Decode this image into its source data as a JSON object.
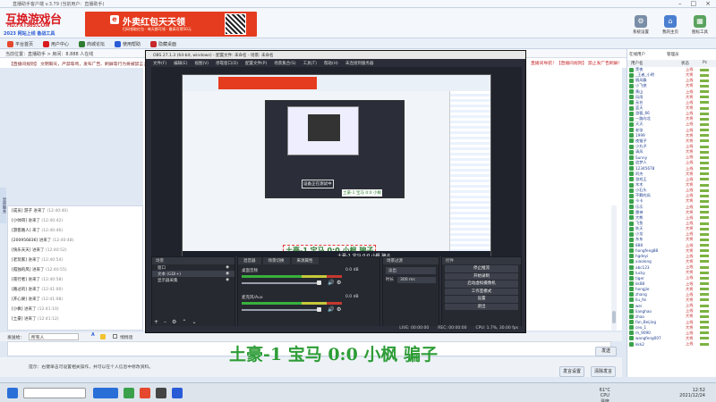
{
  "window": {
    "title": "直播助手客户端 v.3.79 (当前用户：直播助手)"
  },
  "logo": {
    "brand": "互换游戏台",
    "url": "HD.FXT365.COM",
    "tagline": "2023 网站上线 备战工具"
  },
  "ad": {
    "headline": "外卖红包天天领",
    "sub": "扫码领取红包 · 每天都可领 · 最高可得50元"
  },
  "top_icons": [
    {
      "label": "系统设置"
    },
    {
      "label": "我的主页"
    },
    {
      "label": "图标工具"
    }
  ],
  "toolbar": {
    "items": [
      {
        "label": "平台首页",
        "color": "#e5482d"
      },
      {
        "label": "用户中心",
        "color": "#d8191e"
      },
      {
        "label": "商城论坛",
        "color": "#2e7d32"
      },
      {
        "label": "使用帮助",
        "color": "#2a5bd7"
      },
      {
        "label": "隐藏桌面",
        "color": "#c6282c"
      }
    ]
  },
  "subbar": {
    "text": "当前位置：直播助手  >  房间：8.888 人在线"
  },
  "announcement": {
    "text": "【直播间规则】 文明聊天，严禁辱骂，发布广告、刷屏等行为将被禁言；请大家互相尊重，共同维护良好的直播环境。",
    "right": "直播间导航！【直播间规则】 禁止发广告刷屏！"
  },
  "side_tab": "显示聊天",
  "chat": [
    {
      "name": "[成员] 游子",
      "text": "进来了",
      "time": "(12:40:40)"
    },
    {
      "name": "[小帅哥]",
      "text": "进来了",
      "time": "(12:40:42)"
    },
    {
      "name": "[游客路人]",
      "text": "来了",
      "time": "(12:40:46)"
    },
    {
      "name": "[200956836]",
      "text": "进来了",
      "time": "(12:40:48)"
    },
    {
      "name": "[快乐天天]",
      "text": "进来了",
      "time": "(12:40:52)"
    },
    {
      "name": "[老玩家]",
      "text": "进来了",
      "time": "(12:40:54)"
    },
    {
      "name": "[孤独的风]",
      "text": "进来了",
      "time": "(12:40:55)"
    },
    {
      "name": "[夜行者]",
      "text": "进来了",
      "time": "(12:40:58)"
    },
    {
      "name": "[路过的]",
      "text": "进来了",
      "time": "(12:41:00)"
    },
    {
      "name": "[开心果]",
      "text": "进来了",
      "time": "(12:41:08)"
    },
    {
      "name": "[小枫]",
      "text": "进来了",
      "time": "(12:41:10)"
    },
    {
      "name": "[土豪]",
      "text": "进来了",
      "time": "(12:41:12)"
    }
  ],
  "input_row": {
    "label": "发送给：",
    "target": "所有人",
    "checkbox": "悄悄话"
  },
  "send_button": "发送",
  "status": "提示：右键单击可设置相关操作，并可以在个人信息中修改资料。",
  "bottom_buttons": {
    "settings": "发言设置",
    "clear": "清除发言"
  },
  "userpanel": {
    "tabs": [
      "在线用户",
      "管理员"
    ],
    "header": [
      "用户名",
      "状态",
      "Pc"
    ]
  },
  "users": [
    {
      "name": "黑夜",
      "tag": "上线"
    },
    {
      "name": "_王者_小明",
      "tag": "大将"
    },
    {
      "name": "随风飘",
      "tag": "上线"
    },
    {
      "name": "小飞侠",
      "tag": "大将"
    },
    {
      "name": "黄山",
      "tag": "上线"
    },
    {
      "name": "风雨",
      "tag": "大将"
    },
    {
      "name": "无名",
      "tag": "上线"
    },
    {
      "name": "蓝天",
      "tag": "大将"
    },
    {
      "name": "游客_66",
      "tag": "上线"
    },
    {
      "name": "一路向北",
      "tag": "大将"
    },
    {
      "name": "天天",
      "tag": "上线"
    },
    {
      "name": "老张",
      "tag": "上线"
    },
    {
      "name": "1999",
      "tag": "大将"
    },
    {
      "name": "夜猫子",
      "tag": "大将"
    },
    {
      "name": "小丸子",
      "tag": "上线"
    },
    {
      "name": "清风",
      "tag": "大将"
    },
    {
      "name": "Sunny",
      "tag": "上线"
    },
    {
      "name": "追梦人",
      "tag": "上线"
    },
    {
      "name": "12345678",
      "tag": "上线"
    },
    {
      "name": "阿杰",
      "tag": "大将"
    },
    {
      "name": "游戏王",
      "tag": "上线"
    },
    {
      "name": "木木",
      "tag": "大将"
    },
    {
      "name": "小石头",
      "tag": "上线"
    },
    {
      "name": "不羁的风",
      "tag": "上线"
    },
    {
      "name": "卡卡",
      "tag": "大将"
    },
    {
      "name": "乐乐",
      "tag": "上线"
    },
    {
      "name": "雷神",
      "tag": "大将"
    },
    {
      "name": "大熊",
      "tag": "上线"
    },
    {
      "name": "飞鱼",
      "tag": "上线"
    },
    {
      "name": "秋天",
      "tag": "大将"
    },
    {
      "name": "小龙",
      "tag": "上线"
    },
    {
      "name": "东东",
      "tag": "大将"
    },
    {
      "name": "888",
      "tag": "上线"
    },
    {
      "name": "hongfeng88",
      "tag": "大将"
    },
    {
      "name": "hgdeyi",
      "tag": "上线"
    },
    {
      "name": "xiaolong",
      "tag": "大将"
    },
    {
      "name": "abc123",
      "tag": "上线"
    },
    {
      "name": "lucky",
      "tag": "大将"
    },
    {
      "name": "tiger",
      "tag": "上线"
    },
    {
      "name": "kk88",
      "tag": "上线"
    },
    {
      "name": "hongjie",
      "tag": "大将"
    },
    {
      "name": "zhang",
      "tag": "上线"
    },
    {
      "name": "liu_fei",
      "tag": "大将"
    },
    {
      "name": "wei",
      "tag": "上线"
    },
    {
      "name": "lianghao",
      "tag": "上线"
    },
    {
      "name": "zhao",
      "tag": "大将"
    },
    {
      "name": "fan_Beijing",
      "tag": "上线"
    },
    {
      "name": "ceo_1",
      "tag": "大将"
    },
    {
      "name": "m_9090",
      "tag": "上线"
    },
    {
      "name": "wangfeng007",
      "tag": "大将"
    },
    {
      "name": "kkk2",
      "tag": "上线"
    }
  ],
  "obs": {
    "title": "OBS 27.1.3 (64-bit, windows) - 配置文件: 未命名 - 场景: 未命名",
    "menu": [
      "文件(F)",
      "编辑(E)",
      "视图(V)",
      "停靠窗口(D)",
      "配置文件(P)",
      "场景集合(S)",
      "工具(T)",
      "帮助(H)",
      "未连接到服务器"
    ],
    "scenes_header": "场景",
    "sources": [
      {
        "name": "窗口"
      },
      {
        "name": "文本 (GDI+)"
      },
      {
        "name": "显示器采集"
      }
    ],
    "mixer_tabs": [
      "混音器",
      "场景切换",
      "来源属性"
    ],
    "mixer_channels": [
      {
        "name": "桌面音频",
        "db": "0.0 dB"
      },
      {
        "name": "麦克风/Aux",
        "db": "0.0 dB"
      }
    ],
    "transition_header": "场景过渡",
    "transition_type": "淡出",
    "transition_duration_label": "时长",
    "transition_duration": "300 ms",
    "controls_header": "控件",
    "controls": [
      "停止推流",
      "开始录制",
      "启动虚拟摄像机",
      "工作室模式",
      "设置",
      "退出"
    ],
    "status": [
      "LIVE: 00:00:00",
      "REC: 00:00:00",
      "CPU: 1.7%, 30.00 fps"
    ],
    "source_bar": "土豪-1 宝马 0:0 小枫 骗子",
    "preview_caption": "土豪-1 宝马 0:0 小枫 骗子",
    "preview_caption_small": "土豪-1 宝马 0:0 小枫",
    "nested_caption": "设备正在测试中"
  },
  "big_caption": "土豪-1 宝马 0:0 小枫 骗子",
  "taskbar": {
    "time": "12:52",
    "date": "2021/12/24",
    "temp": "61°C",
    "temp_label": "CPU温度"
  },
  "accent_colors": {
    "brand_red": "#d8191e",
    "ad_red": "#e53b1f",
    "caption_green": "#2e9d37",
    "obs_dark": "#2b2e38"
  }
}
